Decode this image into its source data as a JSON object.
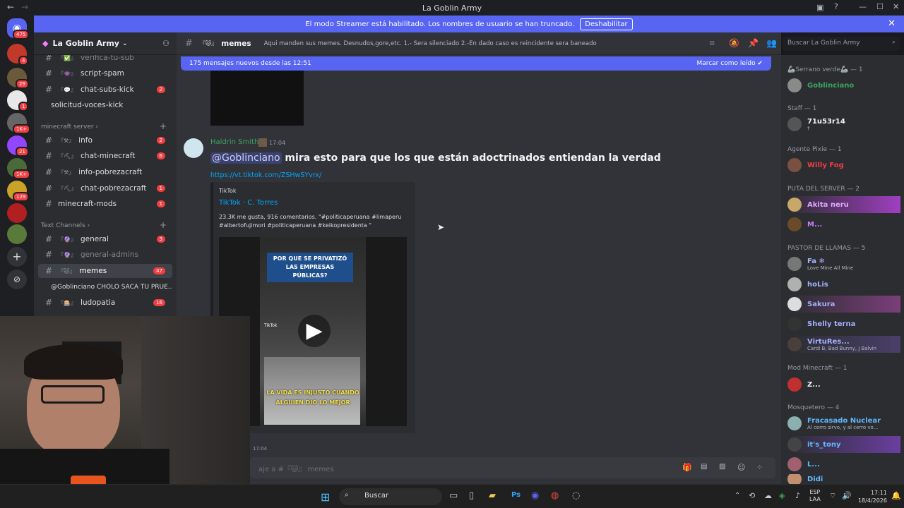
{
  "window": {
    "title": "La Goblin Army"
  },
  "banner": {
    "text": "El modo Streamer está habilitado. Los nombres de usuario se han truncado.",
    "button": "Deshabilitar"
  },
  "servers": {
    "badges": [
      "475",
      "4",
      "29",
      "1",
      "1K+",
      "21",
      "1K+",
      "129"
    ]
  },
  "server": {
    "name": "La Goblin Army",
    "chevron": "chevron-down-icon"
  },
  "channels": {
    "top": [
      {
        "emoji": "『✅』",
        "name": "verifica-tu-sub",
        "count": ""
      },
      {
        "emoji": "『👾』",
        "name": "script-spam",
        "count": ""
      },
      {
        "emoji": "『💬』",
        "name": "chat-subs-kick",
        "count": "2"
      },
      {
        "emoji": "",
        "name": "solicitud-voces-kick",
        "count": ""
      }
    ],
    "cat_minecraft": "minecraft server",
    "minecraft": [
      {
        "emoji": "『⚒』",
        "name": "info",
        "count": "2"
      },
      {
        "emoji": "『⛏』",
        "name": "chat-minecraft",
        "count": "6"
      },
      {
        "emoji": "『⚒』",
        "name": "info-pobrezacraft",
        "count": ""
      },
      {
        "emoji": "『⛏』",
        "name": "chat-pobrezacraft",
        "count": "1"
      },
      {
        "emoji": "",
        "name": "minecraft-mods",
        "count": "1"
      }
    ],
    "cat_text": "Text Channels",
    "text": [
      {
        "emoji": "『🔮』",
        "name": "general",
        "count": "3"
      },
      {
        "emoji": "『🔮』",
        "name": "general-admins",
        "count": ""
      },
      {
        "emoji": "『🐱』",
        "name": "memes",
        "count": "47"
      }
    ],
    "thread": "@Goblinciano CHOLO SACA TU PRUE...",
    "last": {
      "emoji": "『🎰』",
      "name": "ludopatia",
      "count": "16"
    }
  },
  "header": {
    "channel_emoji": "『🐱』",
    "channel": "memes",
    "topic": "Aqui manden sus memes. Desnudos,gore,etc. 1.- Sera silenciado 2.-En dado caso es reincidente sera baneado",
    "search_placeholder": "Buscar La Goblin Army"
  },
  "newbar": {
    "text": "175 mensajes nuevos desde las 12:51",
    "action": "Marcar como leído"
  },
  "message": {
    "author": "Haldrin Smith",
    "time": "17:04",
    "mention": "@Goblinciano",
    "text": " mira esto para que los que están adoctrinados entiendan la verdad",
    "link": "https://vt.tiktok.com/ZSHwSYvrx/",
    "embed": {
      "provider": "TikTok",
      "title": "TikTok · C. Torres",
      "desc": "23.3K me gusta, 916 comentarios. \"#politicaperuana #limaperu #albertofujimori #politicaperuana #keikopresidenta \"",
      "video_top": "POR QUE SE PRIVATIZÓ LAS EMPRESAS PÚBLICAS?",
      "video_bottom": "LA VIDA ES INJUSTO CUANDO ALGUIEN DIO LO MEJOR",
      "tiktok_logo": "TikTok"
    }
  },
  "next_time": "17:04",
  "input": {
    "placeholder": "aje a #『🐱』 memes"
  },
  "members": [
    {
      "cat": "🦾Serrano verde🦾 — 1",
      "users": [
        {
          "name": "Goblinciano",
          "color": "#3ba55d",
          "sub": ""
        }
      ]
    },
    {
      "cat": "Staff — 1",
      "users": [
        {
          "name": "71u53r14",
          "color": "#f2f3f5",
          "sub": "†"
        }
      ]
    },
    {
      "cat": "Agente Pixie — 1",
      "users": [
        {
          "name": "Willy Fog",
          "color": "#f23f43",
          "sub": ""
        }
      ]
    },
    {
      "cat": "PUTA DEL SERVER — 2",
      "users": [
        {
          "name": "Akita neru",
          "color": "#c77dff",
          "sub": ""
        },
        {
          "name": "M...",
          "color": "#c77dff",
          "sub": ""
        }
      ]
    },
    {
      "cat": "PASTOR DE LLAMAS — 5",
      "users": [
        {
          "name": "Fa ❄",
          "color": "#a4b1ff",
          "sub": "Love Mine All Mine"
        },
        {
          "name": "hoLis",
          "color": "#a4b1ff",
          "sub": ""
        },
        {
          "name": "Sakura",
          "color": "#a4b1ff",
          "sub": ""
        },
        {
          "name": "Shelly terna",
          "color": "#a4b1ff",
          "sub": ""
        },
        {
          "name": "VirtuRes...",
          "color": "#a4b1ff",
          "sub": "Cardi B, Bad Bunny, J Balvin"
        }
      ]
    },
    {
      "cat": "Mod Minecraft — 1",
      "users": [
        {
          "name": "Z...",
          "color": "#f2f3f5",
          "sub": ""
        }
      ]
    },
    {
      "cat": "Mosquetero — 4",
      "users": [
        {
          "name": "Fracasado Nuclear",
          "color": "#5fb8ff",
          "sub": "Al cerro sirvo, y al cerro vo..."
        },
        {
          "name": "it's_tony",
          "color": "#5fb8ff",
          "sub": ""
        },
        {
          "name": "L...",
          "color": "#5fb8ff",
          "sub": ""
        },
        {
          "name": "Didi",
          "color": "#5fb8ff",
          "sub": ""
        }
      ]
    }
  ],
  "taskbar": {
    "search": "Buscar",
    "lang": "ESP",
    "lang2": "LAA",
    "time": "17:11",
    "date": "18/4/2026"
  }
}
